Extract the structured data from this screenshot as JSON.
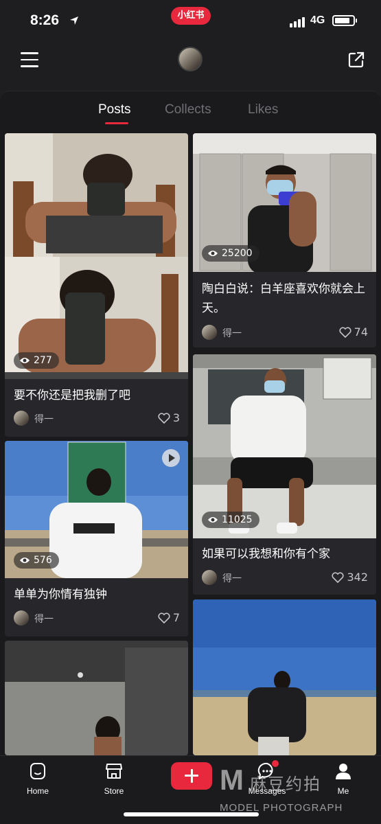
{
  "status_bar": {
    "time": "8:26",
    "network": "4G",
    "battery_level": 0.85
  },
  "app_badge": "小红书",
  "tabs": {
    "posts": "Posts",
    "collects": "Collects",
    "likes": "Likes"
  },
  "colors": {
    "accent": "#e8283d",
    "background": "#1a1a1c",
    "card": "#27272b"
  },
  "posts": [
    {
      "views": "277",
      "title": "要不你还是把我删了吧",
      "author": "得一",
      "likes": "3"
    },
    {
      "views": "25200",
      "title": "陶白白说：白羊座喜欢你就会上天。",
      "author": "得一",
      "likes": "74"
    },
    {
      "views": "11025",
      "title": "如果可以我想和你有个家",
      "author": "得一",
      "likes": "342"
    },
    {
      "views": "576",
      "title": "单单为你情有独钟",
      "author": "得一",
      "likes": "7",
      "is_video": true
    },
    {
      "image_only": true
    },
    {
      "image_only": true
    }
  ],
  "bottom_nav": {
    "home": "Home",
    "store": "Store",
    "messages": "Messages",
    "me": "Me"
  },
  "watermark": {
    "logo": "M",
    "chinese": "麻豆约拍",
    "english": "MODEL PHOTOGRAPH"
  },
  "icons": [
    "menu-icon",
    "share-icon",
    "eye-icon",
    "heart-icon",
    "play-icon",
    "home-icon",
    "store-icon",
    "messages-icon",
    "me-icon",
    "plus-icon"
  ]
}
